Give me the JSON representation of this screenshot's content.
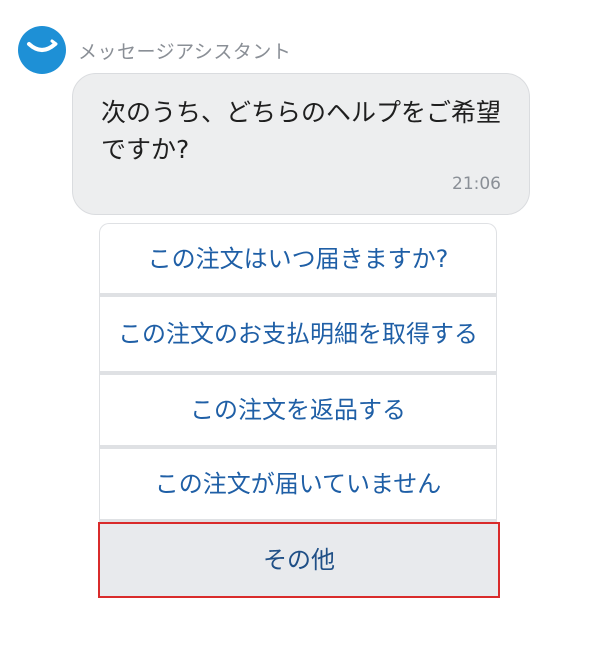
{
  "header": {
    "sender_name": "メッセージアシスタント",
    "avatar_icon": "smile-logo-icon",
    "avatar_color": "#1e90d6"
  },
  "message": {
    "text": "次のうち、どちらのヘルプをご希望ですか?",
    "time": "21:06"
  },
  "options": [
    {
      "label": "この注文はいつ届きますか?"
    },
    {
      "label": "この注文のお支払明細を取得する"
    },
    {
      "label": "この注文を返品する"
    },
    {
      "label": "この注文が届いていません"
    },
    {
      "label": "その他",
      "highlighted": true
    }
  ],
  "colors": {
    "link_text": "#1f5fa6",
    "highlight_border": "#d92b2b",
    "bubble_bg": "#edeeef"
  }
}
